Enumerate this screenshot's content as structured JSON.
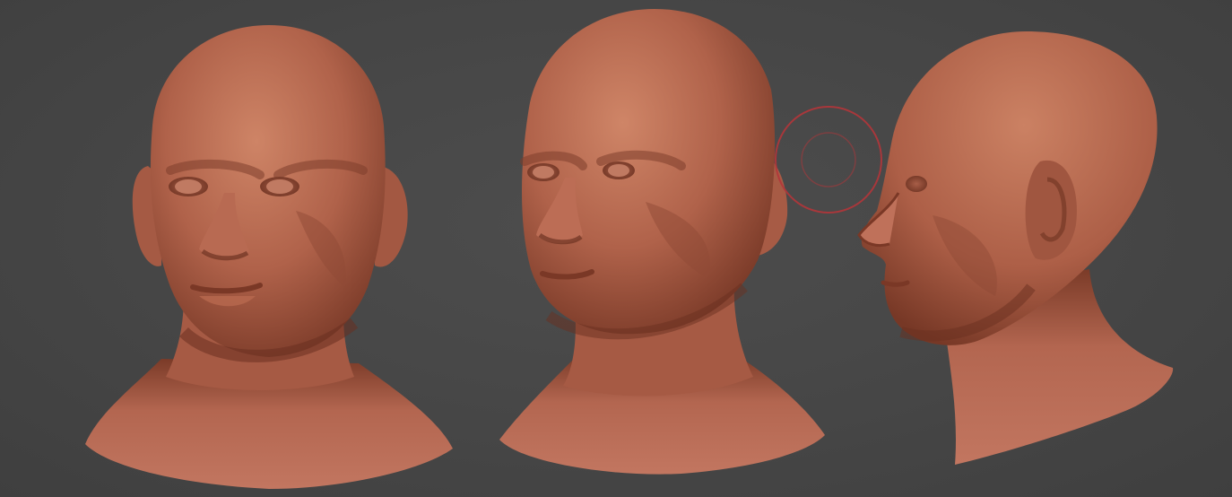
{
  "canvas": {
    "background_color": "#474747",
    "clay_color": "#B0624A",
    "clay_highlight": "#CE8466",
    "clay_shadow": "#6B3222",
    "brush_color": "#B2353A"
  },
  "models": [
    {
      "name": "head-front",
      "view": "front"
    },
    {
      "name": "head-three-quarter",
      "view": "three-quarter"
    },
    {
      "name": "head-side",
      "view": "profile"
    }
  ],
  "brush_cursor": {
    "shape": "double-circle",
    "icon": "brush-cursor-icon"
  }
}
